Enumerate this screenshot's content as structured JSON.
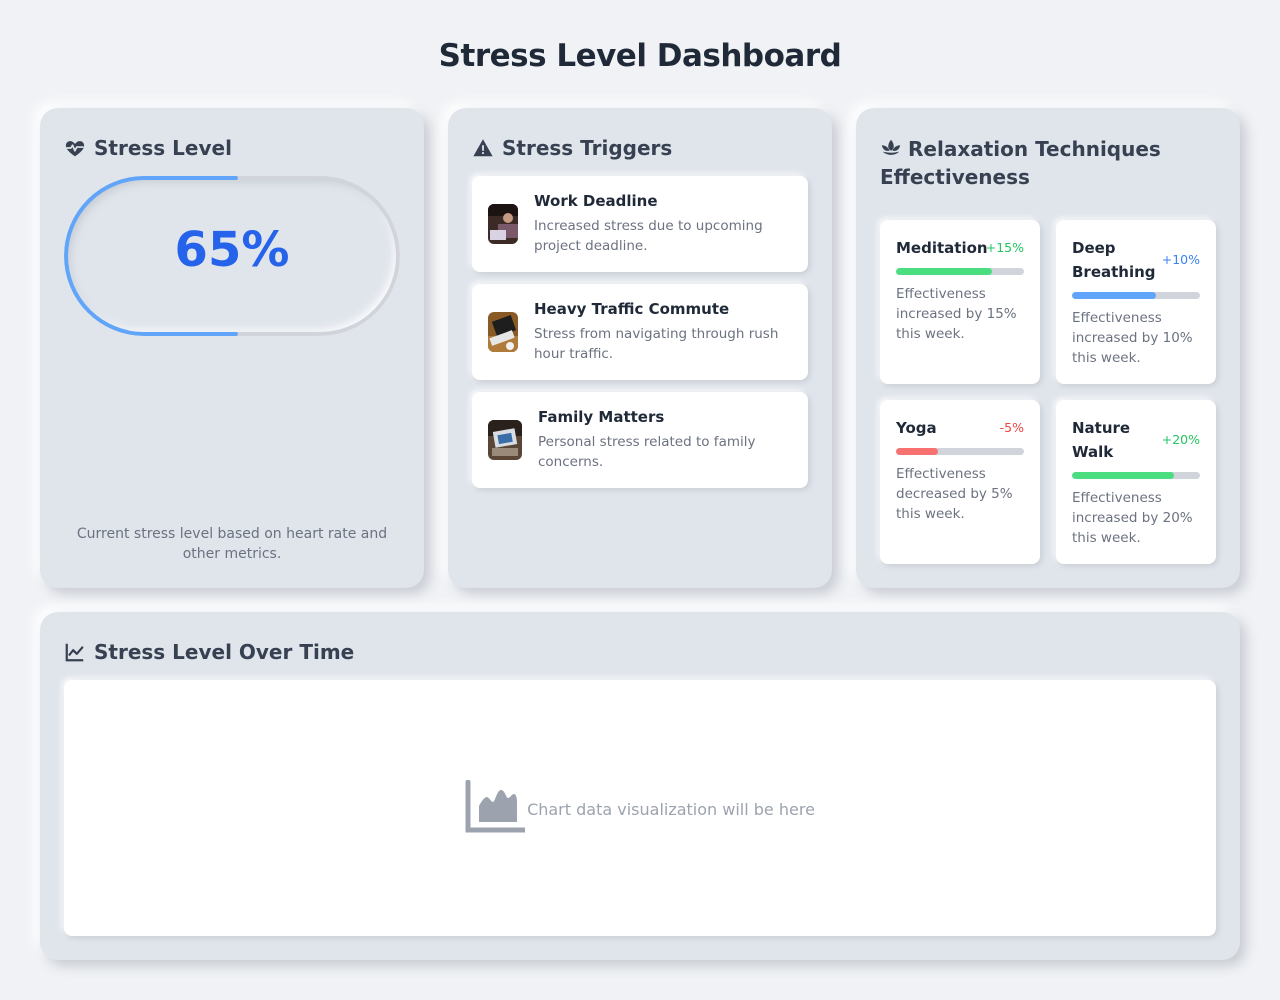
{
  "page": {
    "title": "Stress Level Dashboard"
  },
  "stress_level": {
    "title": "Stress Level",
    "icon": "heart-pulse-icon",
    "value": "65%",
    "fraction": 0.65,
    "caption": "Current stress level based on heart rate and other metrics.",
    "accent_color": "#2563eb",
    "arc_color": "#60a5fa"
  },
  "triggers": {
    "title": "Stress Triggers",
    "icon": "warning-triangle-icon",
    "items": [
      {
        "title": "Work Deadline",
        "desc": "Increased stress due to upcoming project deadline."
      },
      {
        "title": "Heavy Traffic Commute",
        "desc": "Stress from navigating through rush hour traffic."
      },
      {
        "title": "Family Matters",
        "desc": "Personal stress related to family concerns."
      }
    ]
  },
  "techniques": {
    "title": "Relaxation Techniques Effectiveness",
    "icon": "lotus-icon",
    "items": [
      {
        "name": "Meditation",
        "change": "+15%",
        "level": 0.75,
        "color": "#4ade80",
        "change_color": "#22c55e",
        "desc": "Effectiveness increased by 15% this week."
      },
      {
        "name": "Deep Breathing",
        "change": "+10%",
        "level": 0.66,
        "color": "#60a5fa",
        "change_color": "#3b82f6",
        "desc": "Effectiveness increased by 10% this week."
      },
      {
        "name": "Yoga",
        "change": "-5%",
        "level": 0.33,
        "color": "#f87171",
        "change_color": "#ef4444",
        "desc": "Effectiveness decreased by 5% this week."
      },
      {
        "name": "Nature Walk",
        "change": "+20%",
        "level": 0.8,
        "color": "#4ade80",
        "change_color": "#22c55e",
        "desc": "Effectiveness increased by 20% this week."
      }
    ]
  },
  "chart": {
    "title": "Stress Level Over Time",
    "icon": "line-chart-icon",
    "placeholder": "Chart data visualization will be here",
    "placeholder_icon": "area-chart-icon"
  }
}
